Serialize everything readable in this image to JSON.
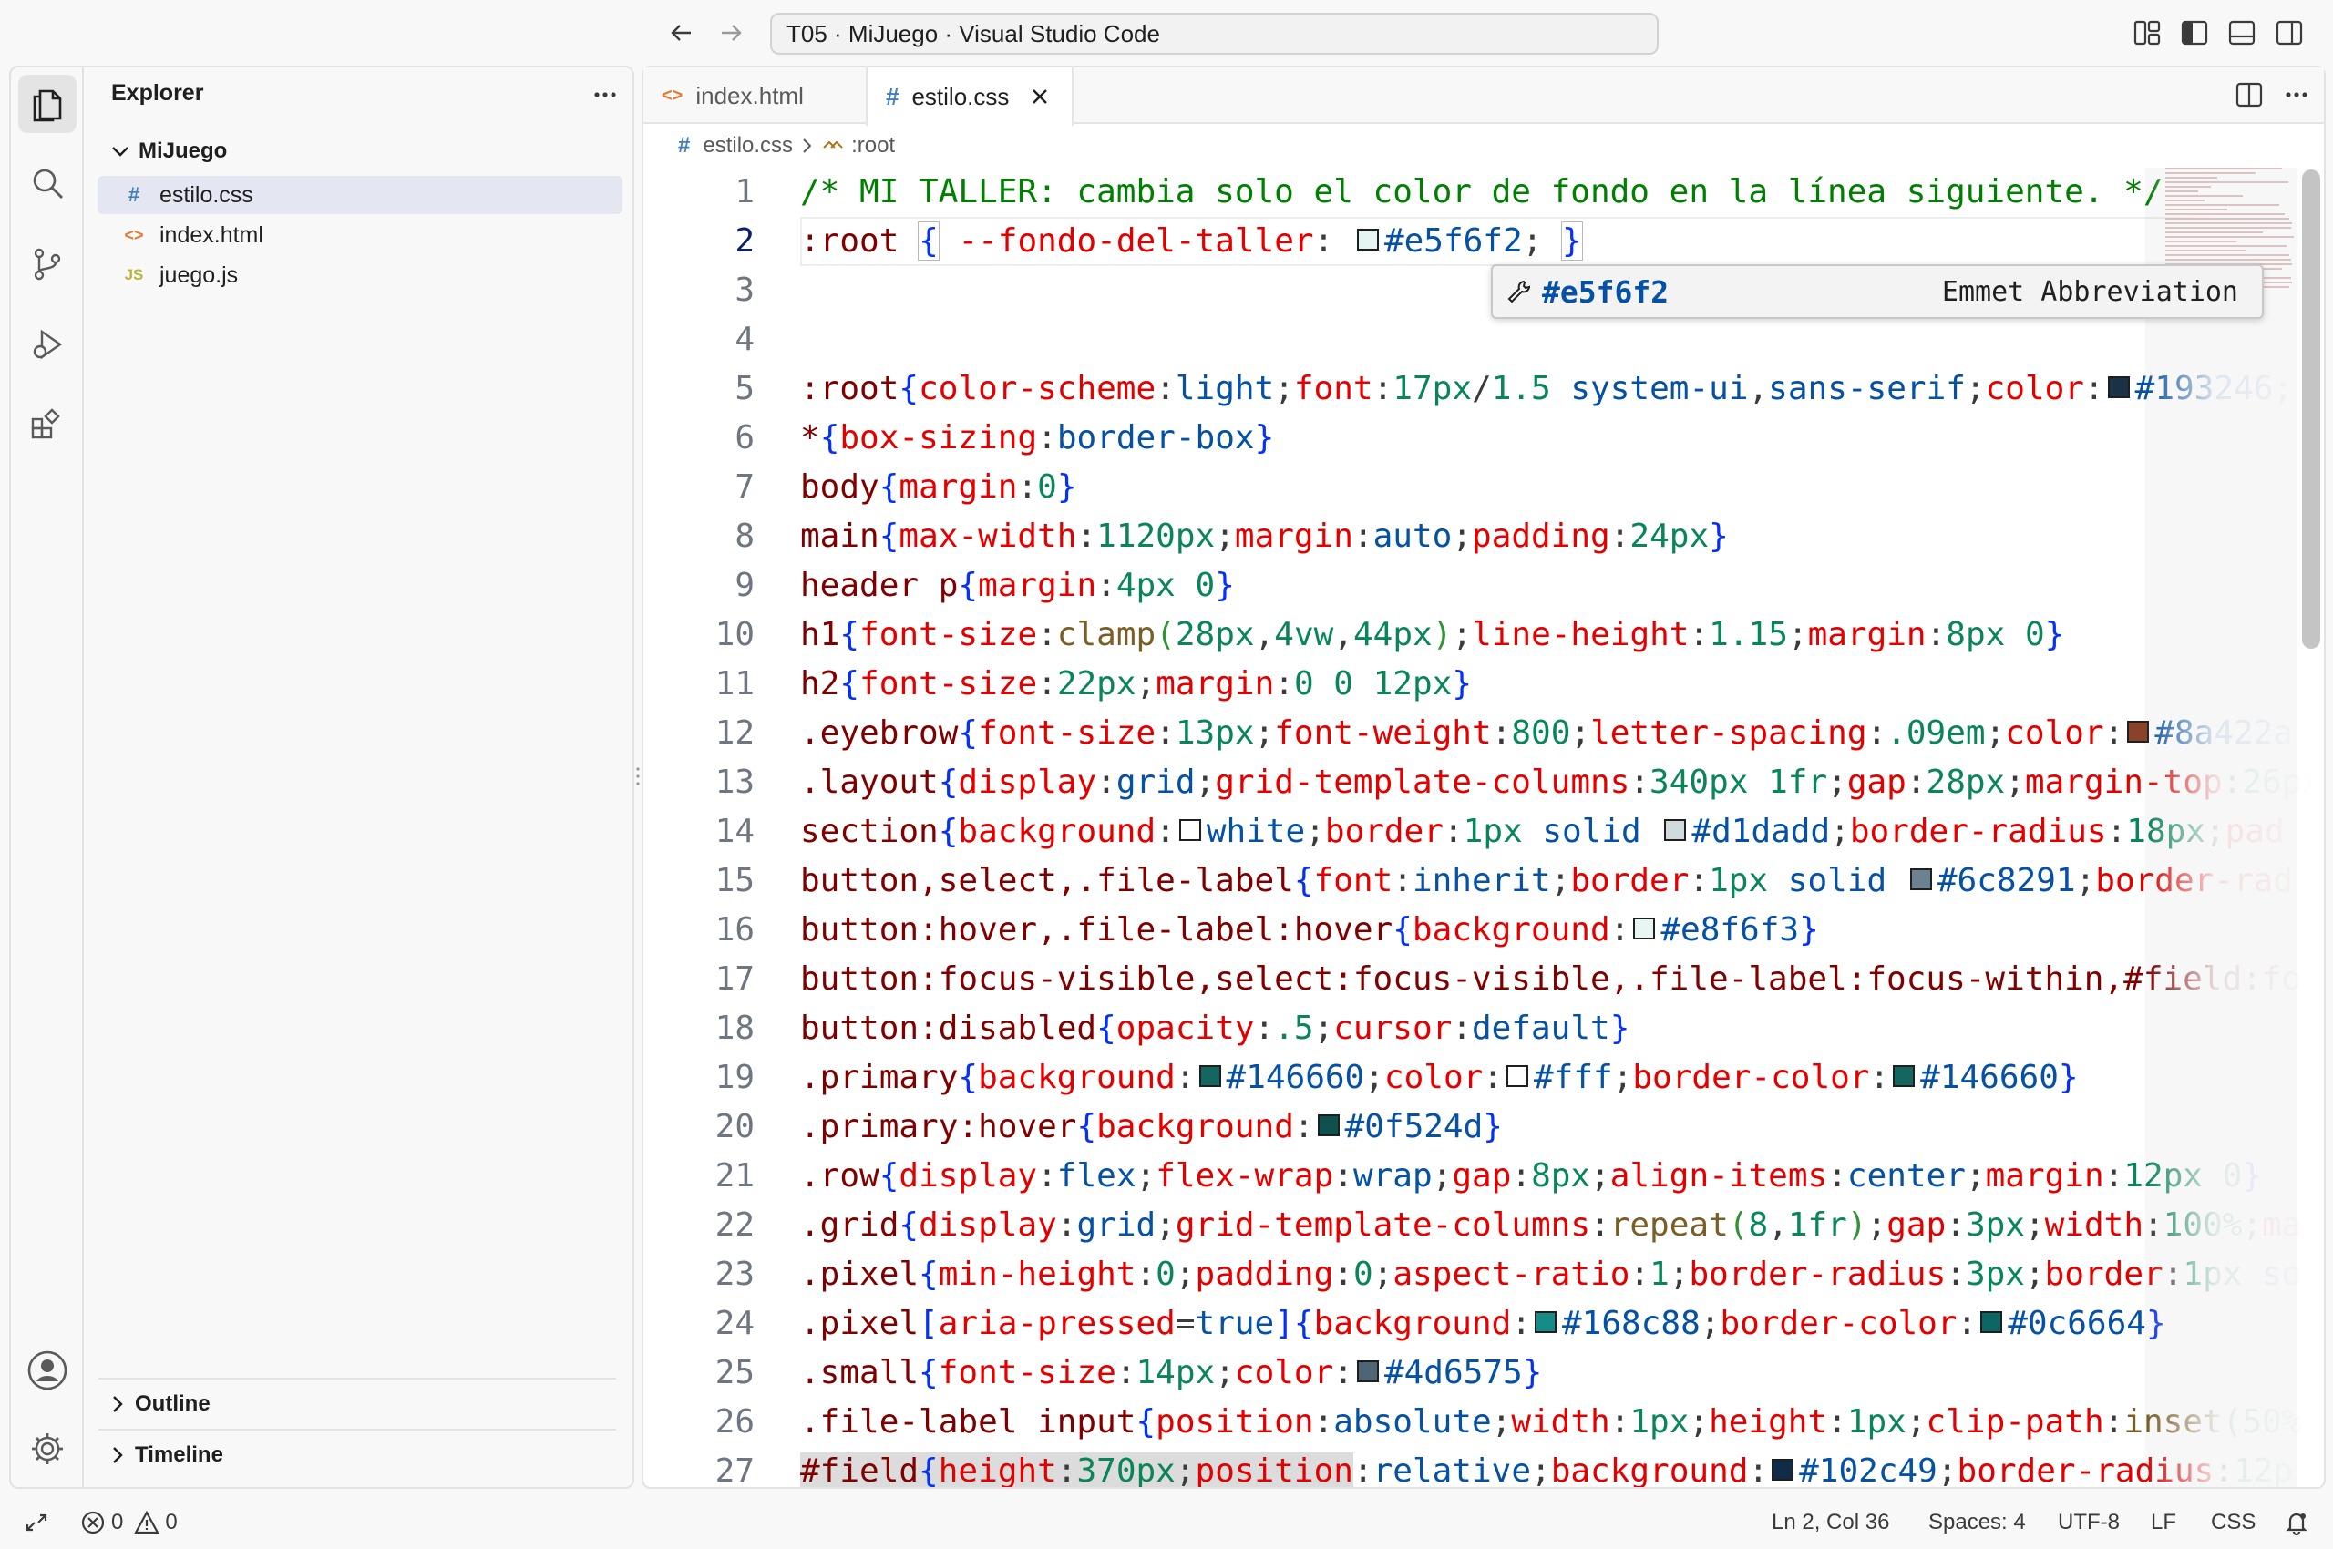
{
  "window": {
    "title": "T05 · MiJuego · Visual Studio Code"
  },
  "explorer": {
    "title": "Explorer",
    "folder": "MiJuego",
    "files": [
      {
        "icon": "#",
        "name": "estilo.css",
        "color": "#3f7fbf"
      },
      {
        "icon": "<>",
        "name": "index.html",
        "color": "#e37933"
      },
      {
        "icon": "JS",
        "name": "juego.js",
        "color": "#cbcb41"
      }
    ],
    "panels": [
      "Outline",
      "Timeline"
    ]
  },
  "tabs": [
    {
      "icon": "<>",
      "label": "index.html"
    },
    {
      "icon": "#",
      "label": "estilo.css"
    }
  ],
  "breadcrumb": {
    "file": "estilo.css",
    "symbol": ":root"
  },
  "code": {
    "line_numbers": [
      "1",
      "2",
      "3",
      "4",
      "5",
      "6",
      "7",
      "8",
      "9",
      "10",
      "11",
      "12",
      "13",
      "14",
      "15",
      "16",
      "17",
      "18",
      "19",
      "20",
      "21",
      "22",
      "23",
      "24",
      "25",
      "26",
      "27"
    ],
    "current_line": 2
  },
  "suggestion": {
    "label": "#e5f6f2",
    "detail": "Emmet Abbreviation"
  },
  "colors": {
    "swatch_e5f6f2": "#e5f6f2",
    "swatch_193246": "#193246",
    "swatch_8a422a": "#8a422a",
    "swatch_white": "#ffffff",
    "swatch_d1dadd": "#d1dadd",
    "swatch_6c8291": "#6c8291",
    "swatch_e8f6f3": "#e8f6f3",
    "swatch_146660": "#146660",
    "swatch_0f524d": "#0f524d",
    "swatch_168c88": "#168c88",
    "swatch_0c6664": "#0c6664",
    "swatch_4d6575": "#4d6575",
    "swatch_102c49": "#102c49"
  },
  "status": {
    "errors": "0",
    "warnings": "0",
    "position": "Ln 2, Col 36",
    "indent": "Spaces: 4",
    "encoding": "UTF-8",
    "eol": "LF",
    "language": "CSS"
  }
}
